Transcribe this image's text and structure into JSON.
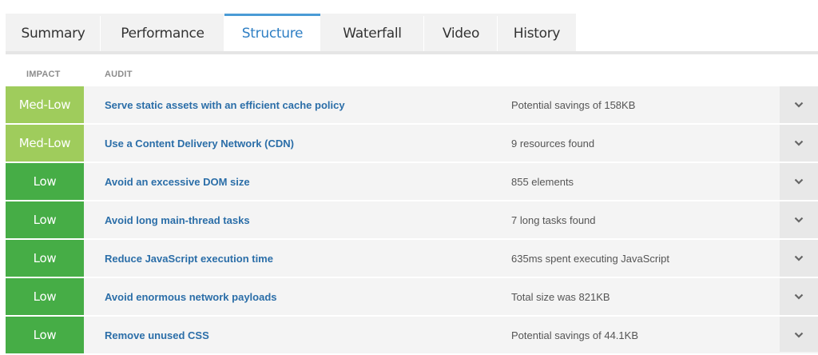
{
  "tabs": [
    {
      "label": "Summary",
      "active": false
    },
    {
      "label": "Performance",
      "active": false
    },
    {
      "label": "Structure",
      "active": true
    },
    {
      "label": "Waterfall",
      "active": false
    },
    {
      "label": "Video",
      "active": false
    },
    {
      "label": "History",
      "active": false
    }
  ],
  "columns": {
    "impact": "IMPACT",
    "audit": "AUDIT"
  },
  "colors": {
    "med_low": "#9fcc5c",
    "low": "#46ad46",
    "link": "#2b6ea8",
    "active_tab": "#4a9bd6"
  },
  "audits": [
    {
      "impact": "Med-Low",
      "title": "Serve static assets with an efficient cache policy",
      "result": "Potential savings of 158KB",
      "expand_icon": "chevron-down-icon"
    },
    {
      "impact": "Med-Low",
      "title": "Use a Content Delivery Network (CDN)",
      "result": "9 resources found",
      "expand_icon": "chevron-down-icon"
    },
    {
      "impact": "Low",
      "title": "Avoid an excessive DOM size",
      "result": "855 elements",
      "expand_icon": "chevron-down-icon"
    },
    {
      "impact": "Low",
      "title": "Avoid long main-thread tasks",
      "result": "7 long tasks found",
      "expand_icon": "chevron-down-icon"
    },
    {
      "impact": "Low",
      "title": "Reduce JavaScript execution time",
      "result": "635ms spent executing JavaScript",
      "expand_icon": "chevron-down-icon"
    },
    {
      "impact": "Low",
      "title": "Avoid enormous network payloads",
      "result": "Total size was 821KB",
      "expand_icon": "chevron-down-icon"
    },
    {
      "impact": "Low",
      "title": "Remove unused CSS",
      "result": "Potential savings of 44.1KB",
      "expand_icon": "chevron-down-icon"
    }
  ]
}
